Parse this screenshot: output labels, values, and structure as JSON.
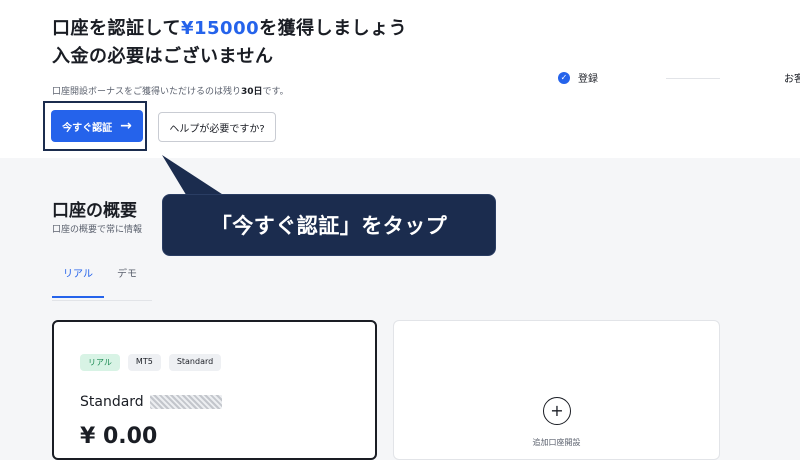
{
  "hero": {
    "line1_prefix": "口座を認証して",
    "line1_amount": "¥15000",
    "line1_suffix": "を獲得しましょう",
    "line2": "入金の必要はございません",
    "note_prefix": "口座開設ボーナスをご獲得いただけるのは残り",
    "note_days": "30日",
    "note_suffix": "です。",
    "verify_label": "今すぐ認証",
    "verify_arrow": "→",
    "help_label": "ヘルプが必要ですか?"
  },
  "steps": {
    "check_icon": "✓",
    "step1": "登録",
    "step2": "お客"
  },
  "overview": {
    "title": "口座の概要",
    "subtitle": "口座の概要で常に情報",
    "tab_real": "リアル",
    "tab_demo": "デモ"
  },
  "callout": {
    "text": "「今すぐ認証」をタップ"
  },
  "account_card": {
    "badge_real": "リアル",
    "badge_platform": "MT5",
    "badge_type": "Standard",
    "name": "Standard",
    "balance": "¥ 0.00"
  },
  "add_card": {
    "plus_icon": "+",
    "label": "追加口座開設"
  },
  "colors": {
    "accent": "#2563eb",
    "callout_bg": "#1b2c4e",
    "badge_real_bg": "#d8f3e5"
  }
}
